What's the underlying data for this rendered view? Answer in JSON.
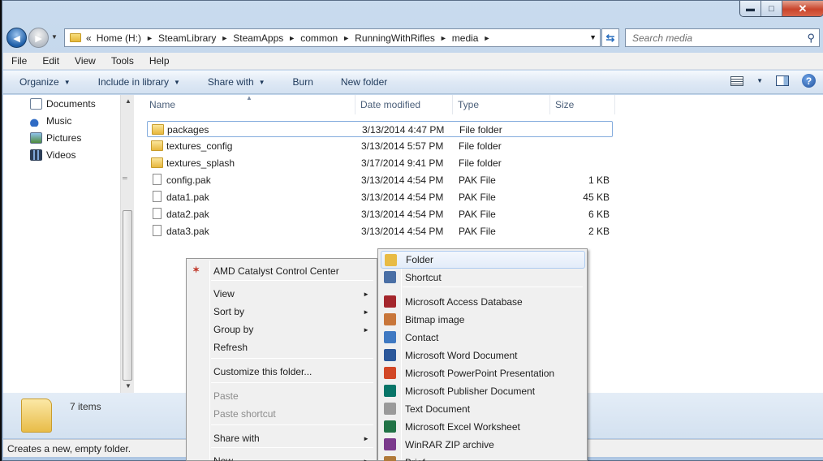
{
  "window": {
    "controls": {
      "minimize": "▬",
      "maximize": "□",
      "close": "✕"
    }
  },
  "address_bar": {
    "overflow": "«",
    "crumbs": [
      "Home (H:)",
      "SteamLibrary",
      "SteamApps",
      "common",
      "RunningWithRifles",
      "media"
    ],
    "search_placeholder": "Search media"
  },
  "menu": [
    "File",
    "Edit",
    "View",
    "Tools",
    "Help"
  ],
  "commands": [
    "Organize",
    "Include in library",
    "Share with",
    "Burn",
    "New folder"
  ],
  "nav_pane": [
    "Documents",
    "Music",
    "Pictures",
    "Videos"
  ],
  "columns": [
    "Name",
    "Date modified",
    "Type",
    "Size"
  ],
  "files": [
    {
      "name": "packages",
      "date": "3/13/2014 4:47 PM",
      "type": "File folder",
      "size": "",
      "kind": "folder"
    },
    {
      "name": "textures_config",
      "date": "3/13/2014 5:57 PM",
      "type": "File folder",
      "size": "",
      "kind": "folder"
    },
    {
      "name": "textures_splash",
      "date": "3/17/2014 9:41 PM",
      "type": "File folder",
      "size": "",
      "kind": "folder"
    },
    {
      "name": "config.pak",
      "date": "3/13/2014 4:54 PM",
      "type": "PAK File",
      "size": "1 KB",
      "kind": "file"
    },
    {
      "name": "data1.pak",
      "date": "3/13/2014 4:54 PM",
      "type": "PAK File",
      "size": "45 KB",
      "kind": "file"
    },
    {
      "name": "data2.pak",
      "date": "3/13/2014 4:54 PM",
      "type": "PAK File",
      "size": "6 KB",
      "kind": "file"
    },
    {
      "name": "data3.pak",
      "date": "3/13/2014 4:54 PM",
      "type": "PAK File",
      "size": "2 KB",
      "kind": "file"
    }
  ],
  "details": {
    "item_count": "7 items"
  },
  "status": {
    "text": "Creates a new, empty folder."
  },
  "context_menu": [
    {
      "label": "AMD Catalyst Control Center",
      "icon": "amd-icon"
    },
    {
      "label": "View",
      "submenu": true
    },
    {
      "label": "Sort by",
      "submenu": true
    },
    {
      "label": "Group by",
      "submenu": true
    },
    {
      "label": "Refresh"
    },
    {
      "label": "Customize this folder..."
    },
    {
      "label": "Paste",
      "disabled": true
    },
    {
      "label": "Paste shortcut",
      "disabled": true
    },
    {
      "label": "Share with",
      "submenu": true
    },
    {
      "label": "New",
      "submenu": true
    }
  ],
  "new_submenu": [
    {
      "label": "Folder",
      "icon": "folder-icon",
      "color": "#e8bb45"
    },
    {
      "label": "Shortcut",
      "icon": "shortcut-icon",
      "color": "#4a6fa5"
    },
    {
      "label": "Microsoft Access Database",
      "icon": "access-icon",
      "color": "#a4262c"
    },
    {
      "label": "Bitmap image",
      "icon": "bitmap-icon",
      "color": "#c8763a"
    },
    {
      "label": "Contact",
      "icon": "contact-icon",
      "color": "#3f79c2"
    },
    {
      "label": "Microsoft Word Document",
      "icon": "word-icon",
      "color": "#2b579a"
    },
    {
      "label": "Microsoft PowerPoint Presentation",
      "icon": "powerpoint-icon",
      "color": "#d24726"
    },
    {
      "label": "Microsoft Publisher Document",
      "icon": "publisher-icon",
      "color": "#077568"
    },
    {
      "label": "Text Document",
      "icon": "text-document-icon",
      "color": "#9a9a9a"
    },
    {
      "label": "Microsoft Excel Worksheet",
      "icon": "excel-icon",
      "color": "#217346"
    },
    {
      "label": "WinRAR ZIP archive",
      "icon": "winrar-icon",
      "color": "#7b3a8c"
    },
    {
      "label": "Brief",
      "icon": "briefcase-icon",
      "color": "#b07a3a"
    }
  ]
}
